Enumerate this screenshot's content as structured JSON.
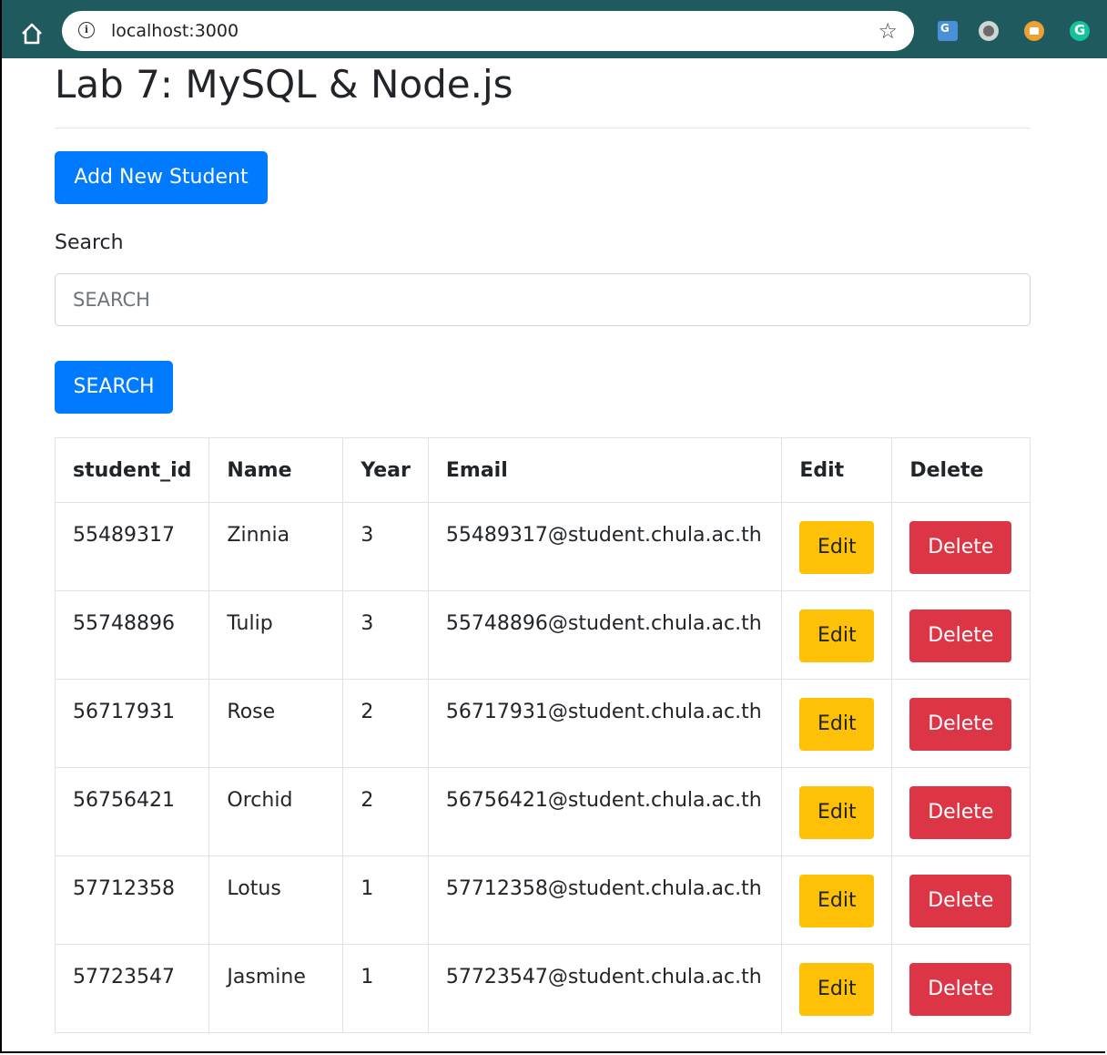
{
  "browser": {
    "url": "localhost:3000",
    "icons": [
      "home-icon",
      "info-icon",
      "star-icon",
      "google-translate-icon",
      "brain-extension-icon",
      "image-extension-icon",
      "grammarly-icon"
    ]
  },
  "page": {
    "title": "Lab 7: MySQL & Node.js",
    "add_button_label": "Add New Student",
    "search_label": "Search",
    "search_placeholder": "SEARCH",
    "search_button_label": "SEARCH"
  },
  "table": {
    "headers": [
      "student_id",
      "Name",
      "Year",
      "Email",
      "Edit",
      "Delete"
    ],
    "edit_label": "Edit",
    "delete_label": "Delete",
    "rows": [
      {
        "student_id": "55489317",
        "name": "Zinnia",
        "year": "3",
        "email": "55489317@student.chula.ac.th"
      },
      {
        "student_id": "55748896",
        "name": "Tulip",
        "year": "3",
        "email": "55748896@student.chula.ac.th"
      },
      {
        "student_id": "56717931",
        "name": "Rose",
        "year": "2",
        "email": "56717931@student.chula.ac.th"
      },
      {
        "student_id": "56756421",
        "name": "Orchid",
        "year": "2",
        "email": "56756421@student.chula.ac.th"
      },
      {
        "student_id": "57712358",
        "name": "Lotus",
        "year": "1",
        "email": "57712358@student.chula.ac.th"
      },
      {
        "student_id": "57723547",
        "name": "Jasmine",
        "year": "1",
        "email": "57723547@student.chula.ac.th"
      }
    ]
  },
  "colors": {
    "primary": "#007bff",
    "warning": "#ffc107",
    "danger": "#dc3545",
    "chrome": "#1f5a5e"
  }
}
